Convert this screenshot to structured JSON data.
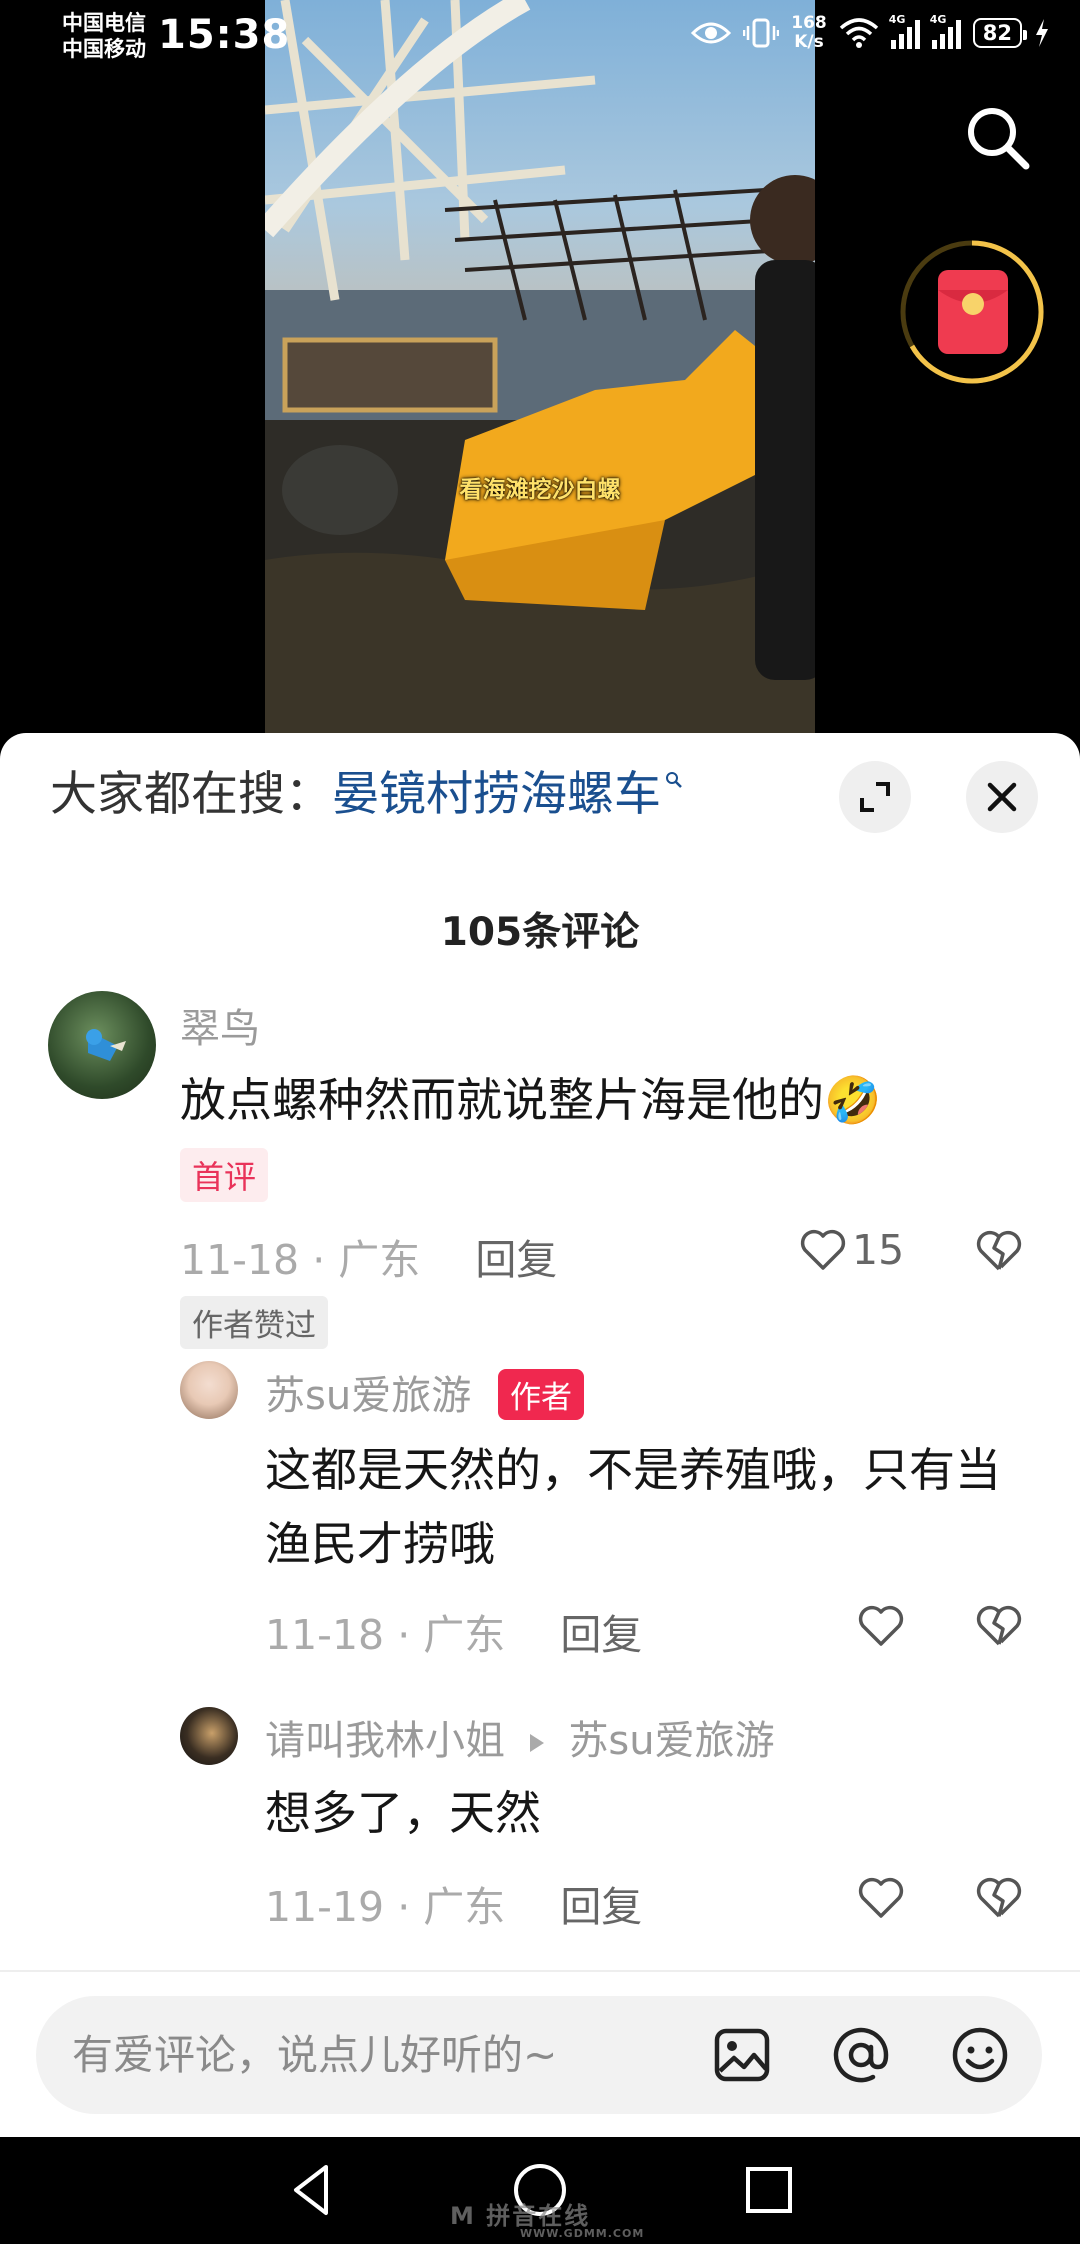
{
  "status_bar": {
    "carrier1": "中国电信",
    "carrier2": "中国移动",
    "time": "15:38",
    "net_speed_value": "168",
    "net_speed_unit": "K/s",
    "signal_label": "4G",
    "battery": "82"
  },
  "video": {
    "caption": "看海滩挖沙白螺"
  },
  "hot_search": {
    "prefix": "大家都在搜：",
    "keyword": "晏镜村捞海螺车"
  },
  "comments_header": {
    "count_text": "105条评论"
  },
  "comments": [
    {
      "username": "翠鸟",
      "text": "放点螺种然而就说整片海是他的🤣",
      "tag": "首评",
      "date": "11-18",
      "location": "广东",
      "reply_label": "回复",
      "likes": "15",
      "author_liked_label": "作者赞过"
    },
    {
      "username": "苏su爱旅游",
      "badge": "作者",
      "text": "这都是天然的，不是养殖哦，只有当渔民才捞哦",
      "date": "11-18",
      "location": "广东",
      "reply_label": "回复"
    },
    {
      "username": "请叫我林小姐",
      "reply_to": "苏su爱旅游",
      "text": "想多了，天然",
      "date": "11-19",
      "location": "广东",
      "reply_label": "回复"
    }
  ],
  "input": {
    "placeholder": "有爱评论，说点儿好听的~"
  },
  "watermark": {
    "brand": "M 拼音在线",
    "url": "WWW.GDMM.COM"
  },
  "colors": {
    "keyword": "#1a4f8f",
    "author_badge": "#f0284f",
    "first_tag": "#e9335a",
    "redpacket": "#ef3b50",
    "ring": "#f3c34a"
  }
}
